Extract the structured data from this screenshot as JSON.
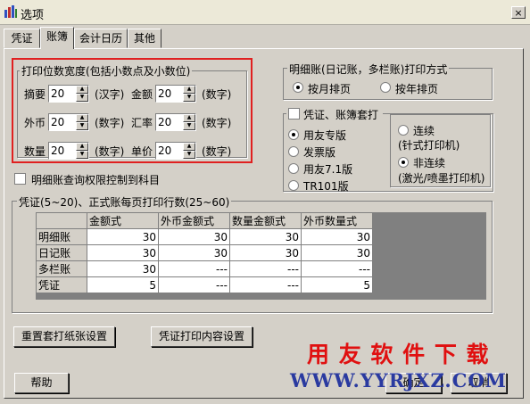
{
  "window": {
    "title": "选项",
    "close": "×"
  },
  "tabs": [
    "凭证",
    "账簿",
    "会计日历",
    "其他"
  ],
  "print_digits": {
    "title": "打印位数宽度(包括小数点及小数位)",
    "rows": [
      {
        "label1": "摘要",
        "value1": "20",
        "unit1": "(汉字)",
        "label2": "金额",
        "value2": "20",
        "unit2": "(数字)"
      },
      {
        "label1": "外币",
        "value1": "20",
        "unit1": "(数字)",
        "label2": "汇率",
        "value2": "20",
        "unit2": "(数字)"
      },
      {
        "label1": "数量",
        "value1": "20",
        "unit1": "(数字)",
        "label2": "单价",
        "value2": "20",
        "unit2": "(数字)"
      }
    ]
  },
  "detail_print": {
    "title": "明细账(日记账，多栏账)打印方式",
    "option_month": "按月排页",
    "option_year": "按年排页",
    "selected": "month"
  },
  "voucher_print": {
    "checkbox": "凭证、账簿套打",
    "options": [
      "用友专版",
      "发票版",
      "用友7.1版",
      "TR101版"
    ],
    "selected": 0,
    "mode_continuous": "连续",
    "mode_continuous_note": "(针式打印机)",
    "mode_noncontinuous": "非连续",
    "mode_noncontinuous_note": "(激光/喷墨打印机)",
    "mode_selected": "noncontinuous"
  },
  "query_permission": {
    "label": "明细账查询权限控制到科目"
  },
  "row_count": {
    "title": "凭证(5~20)、正式账每页打印行数(25~60)",
    "columns": [
      "金额式",
      "外币金额式",
      "数量金额式",
      "外币数量式"
    ],
    "rows": [
      {
        "name": "明细账",
        "cells": [
          "30",
          "30",
          "30",
          "30"
        ]
      },
      {
        "name": "日记账",
        "cells": [
          "30",
          "30",
          "30",
          "30"
        ]
      },
      {
        "name": "多栏账",
        "cells": [
          "30",
          "---",
          "---",
          "---"
        ]
      },
      {
        "name": "凭证",
        "cells": [
          "5",
          "---",
          "---",
          "5"
        ]
      }
    ]
  },
  "buttons": {
    "reset_paper": "重置套打纸张设置",
    "voucher_content": "凭证打印内容设置",
    "help": "帮助",
    "ok": "确定",
    "cancel": "取消"
  },
  "watermark": {
    "line1": "用 友 软 件 下 载",
    "line2": "WWW.YYRJXZ.COM"
  },
  "colors": {
    "highlight_border": "#e02020",
    "watermark_red": "#e01010",
    "watermark_blue": "#2a3aa0"
  }
}
